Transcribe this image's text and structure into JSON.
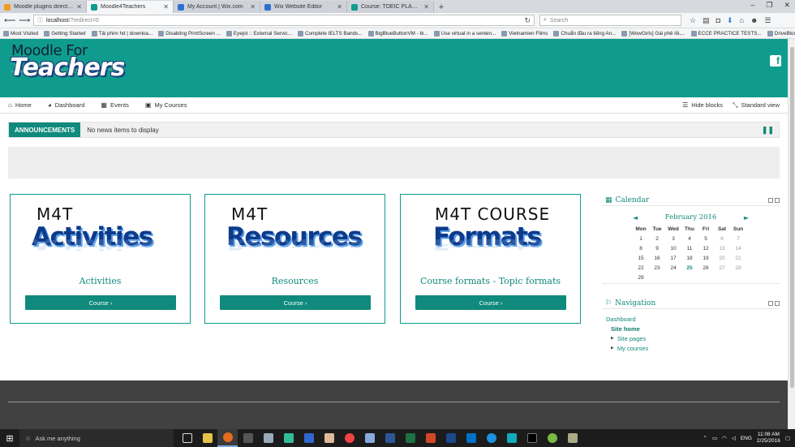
{
  "browser": {
    "tabs": [
      {
        "title": "Moodle plugins directory: ...",
        "color": "#f29b1d",
        "active": false
      },
      {
        "title": "Moodle4Teachers",
        "color": "#0f9c8e",
        "active": true
      },
      {
        "title": "My Account | Wix.com",
        "color": "#2f6fd0",
        "active": false
      },
      {
        "title": "Wix Website Editor",
        "color": "#2f6fd0",
        "active": false
      },
      {
        "title": "Course: TOEIC PLACEME...",
        "color": "#0f9c8e",
        "active": false
      }
    ],
    "new_tab": "+",
    "url_host": "localhost",
    "url_path": "/?redirect=0",
    "search_placeholder": "Search",
    "bookmarks": [
      "Most Visited",
      "Getting Started",
      "Tải phim hd | downloa...",
      "Disabling PrintScreen ...",
      "Eyejot :: External Servic...",
      "Complete IELTS Bands...",
      "BigBlueButtonVM - bi...",
      "Use virtual in a senten...",
      "Vietnamien Films",
      "Chuẩn đầu ra tiếng An...",
      "[WowGirls] Gái phê lôi,...",
      "ECCE PRACTICE TESTS...",
      "DriveBlox Unlimited, a ..."
    ]
  },
  "header": {
    "logo_top": "Moodle For",
    "logo_main": "Teachers"
  },
  "menu": {
    "home": "Home",
    "dashboard": "Dashboard",
    "events": "Events",
    "my_courses": "My Courses",
    "hide_blocks": "Hide blocks",
    "standard_view": "Standard view"
  },
  "announcements": {
    "label": "ANNOUNCEMENTS",
    "text": "No news items to display"
  },
  "cards": [
    {
      "img_small": "M4T",
      "img_big": "Activities",
      "title": "Activities",
      "button": "Course ›"
    },
    {
      "img_small": "M4T",
      "img_big": "Resources",
      "title": "Resources",
      "button": "Course ›"
    },
    {
      "img_small": "M4T  COURSE",
      "img_big": "Formats",
      "title": "Course formats - Topic formats",
      "button": "Course ›"
    }
  ],
  "calendar": {
    "title": "Calendar",
    "month": "February 2016",
    "prev": "◄",
    "next": "►",
    "days": [
      "Mon",
      "Tue",
      "Wed",
      "Thu",
      "Fri",
      "Sat",
      "Sun"
    ],
    "weeks": [
      [
        "1",
        "2",
        "3",
        "4",
        "5",
        "6",
        "7"
      ],
      [
        "8",
        "9",
        "10",
        "11",
        "12",
        "13",
        "14"
      ],
      [
        "15",
        "16",
        "17",
        "18",
        "19",
        "20",
        "21"
      ],
      [
        "22",
        "23",
        "24",
        "25",
        "26",
        "27",
        "28"
      ],
      [
        "29",
        "",
        "",
        "",
        "",
        "",
        ""
      ]
    ],
    "today": "25"
  },
  "navigation": {
    "title": "Navigation",
    "dashboard": "Dashboard",
    "site_home": "Site home",
    "site_pages": "Site pages",
    "my_courses": "My courses"
  },
  "taskbar": {
    "search_placeholder": "Ask me anything",
    "lang": "ENG",
    "time": "11:08 AM",
    "date": "2/25/2016"
  },
  "colors": {
    "brand": "#0f9c8e",
    "brand_dark": "#0f8a7c",
    "footer": "#414141"
  }
}
